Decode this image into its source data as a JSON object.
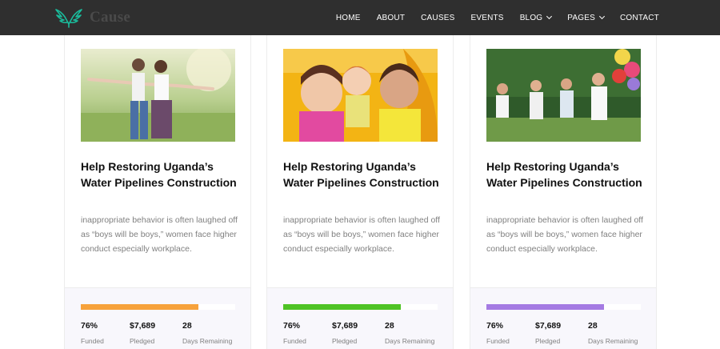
{
  "brand": {
    "name": "Cause",
    "logo_color": "#1abc9c"
  },
  "nav": [
    {
      "label": "HOME",
      "dropdown": false
    },
    {
      "label": "ABOUT",
      "dropdown": false
    },
    {
      "label": "CAUSES",
      "dropdown": false
    },
    {
      "label": "EVENTS",
      "dropdown": false
    },
    {
      "label": "BLOG",
      "dropdown": true
    },
    {
      "label": "PAGES",
      "dropdown": true
    },
    {
      "label": "CONTACT",
      "dropdown": false
    }
  ],
  "cards": [
    {
      "title": "Help Restoring Uganda’s Water Pipelines Construction",
      "description": "inappropriate behavior is often laughed off as “boys will be boys,” women face higher conduct especially workplace.",
      "progress": 0.76,
      "bar_color": "#f7a23b",
      "stats": [
        {
          "value": "76%",
          "label": "Funded"
        },
        {
          "value": "$7,689",
          "label": "Pledged"
        },
        {
          "value": "28",
          "label": "Days Remaining"
        }
      ]
    },
    {
      "title": "Help Restoring Uganda’s Water Pipelines Construction",
      "description": "inappropriate behavior is often laughed off as “boys will be boys,” women face higher conduct especially workplace.",
      "progress": 0.76,
      "bar_color": "#4fc325",
      "stats": [
        {
          "value": "76%",
          "label": "Funded"
        },
        {
          "value": "$7,689",
          "label": "Pledged"
        },
        {
          "value": "28",
          "label": "Days Remaining"
        }
      ]
    },
    {
      "title": "Help Restoring Uganda’s Water Pipelines Construction",
      "description": "inappropriate behavior is often laughed off as “boys will be boys,” women face higher conduct especially workplace.",
      "progress": 0.76,
      "bar_color": "#a57be3",
      "stats": [
        {
          "value": "76%",
          "label": "Funded"
        },
        {
          "value": "$7,689",
          "label": "Pledged"
        },
        {
          "value": "28",
          "label": "Days Remaining"
        }
      ]
    }
  ]
}
